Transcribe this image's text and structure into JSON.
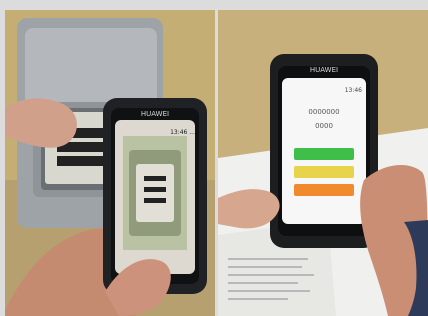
{
  "photo_left": {
    "phone_brand": "HUAWEI",
    "phone_status": "13:46 ...",
    "scene": "smartphone camera pointed at an electricity meter"
  },
  "photo_right": {
    "phone_brand": "HUAWEI",
    "phone_status": "13:46",
    "line1": "0000000",
    "line2": "0000",
    "colors": {
      "button_top": "#3fbf4a",
      "button_mid": "#e7d44a",
      "button_bottom": "#f08a2d"
    }
  }
}
